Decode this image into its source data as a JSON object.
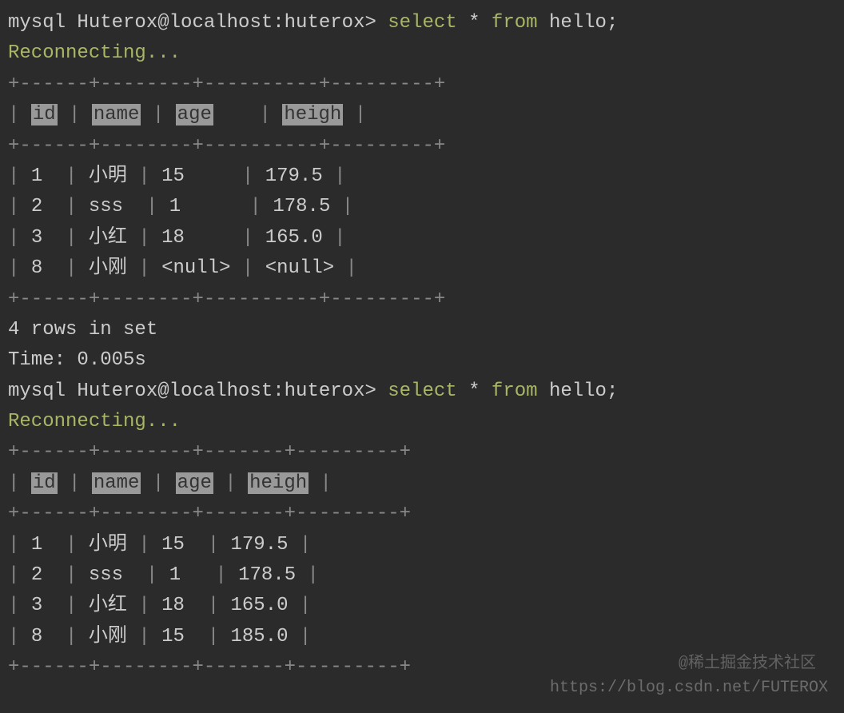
{
  "query1": {
    "prompt": "mysql Huterox@localhost:huterox> ",
    "kw_select": "select",
    "asterisk": "*",
    "kw_from": "from",
    "table_name": "hello;",
    "status": "Reconnecting...",
    "border_top": "+------+--------+----------+---------+",
    "header_row": {
      "id": "id",
      "name": "name",
      "age": "age",
      "heigh": "heigh"
    },
    "border_mid": "+------+--------+----------+---------+",
    "rows": [
      {
        "id": "1",
        "name": "小明",
        "age": "15",
        "heigh": "179.5"
      },
      {
        "id": "2",
        "name": "sss",
        "age": "1",
        "heigh": "178.5"
      },
      {
        "id": "3",
        "name": "小红",
        "age": "18",
        "heigh": "165.0"
      },
      {
        "id": "8",
        "name": "小刚",
        "age": "<null>",
        "heigh": "<null>"
      }
    ],
    "border_bot": "+------+--------+----------+---------+",
    "summary": "4 rows in set",
    "time": "Time: 0.005s"
  },
  "query2": {
    "prompt": "mysql Huterox@localhost:huterox> ",
    "kw_select": "select",
    "asterisk": "*",
    "kw_from": "from",
    "table_name": "hello;",
    "status": "Reconnecting...",
    "border_top": "+------+--------+-------+---------+",
    "header_row": {
      "id": "id",
      "name": "name",
      "age": "age",
      "heigh": "heigh"
    },
    "border_mid": "+------+--------+-------+---------+",
    "rows": [
      {
        "id": "1",
        "name": "小明",
        "age": "15",
        "heigh": "179.5"
      },
      {
        "id": "2",
        "name": "sss",
        "age": "1",
        "heigh": "178.5"
      },
      {
        "id": "3",
        "name": "小红",
        "age": "18",
        "heigh": "165.0"
      },
      {
        "id": "8",
        "name": "小刚",
        "age": "15",
        "heigh": "185.0"
      }
    ],
    "border_bot": "+------+--------+-------+---------+"
  },
  "watermark_cn": "@稀土掘金技术社区",
  "watermark": "https://blog.csdn.net/FUTEROX"
}
